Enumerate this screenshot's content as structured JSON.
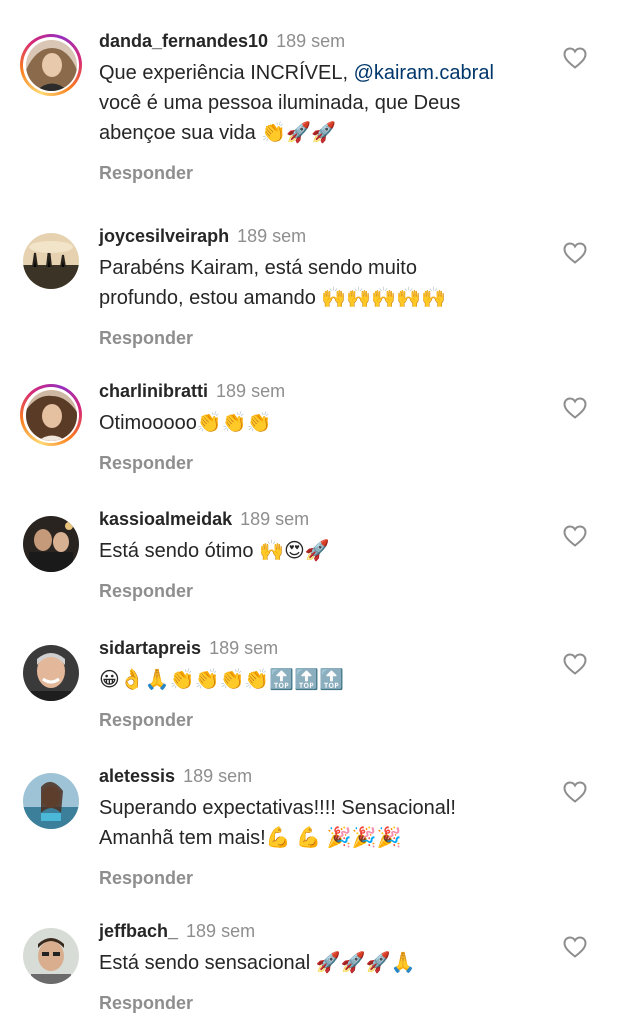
{
  "reply_label": "Responder",
  "comments": [
    {
      "username": "danda_fernandes10",
      "time": "189 sem",
      "text_part1": "Que experiência INCRÍVEL, ",
      "mention": "@kairam.cabral",
      "text_line2": "você é uma pessoa iluminada, que Deus",
      "text_line3": "abençoe sua vida 👏🚀🚀",
      "story_ring": true
    },
    {
      "username": "joycesilveiraph",
      "time": "189 sem",
      "text_line1": "Parabéns Kairam, está  sendo muito",
      "text_line2": "profundo, estou  amando 🙌🙌🙌🙌🙌",
      "story_ring": false
    },
    {
      "username": "charlinibratti",
      "time": "189 sem",
      "text_line1": "Otimooooo👏👏👏",
      "story_ring": true
    },
    {
      "username": "kassioalmeidak",
      "time": "189 sem",
      "text_line1": "Está sendo ótimo 🙌😍🚀",
      "story_ring": false
    },
    {
      "username": "sidartapreis",
      "time": "189 sem",
      "text_line1": "😀👌🙏👏👏👏👏🔝🔝🔝",
      "story_ring": false
    },
    {
      "username": "aletessis",
      "time": "189 sem",
      "text_line1": "Superando expectativas!!!! Sensacional!",
      "text_line2": "Amanhã tem mais!💪 💪 🎉🎉🎉",
      "story_ring": false
    },
    {
      "username": "jeffbach_",
      "time": "189 sem",
      "text_line1": "Está sendo sensacional 🚀🚀🚀🙏",
      "story_ring": false
    }
  ],
  "colors": {
    "text": "#262626",
    "muted": "#8e8e8e",
    "mention": "#00376b",
    "story_ring": [
      "#feda75",
      "#fa7e1e",
      "#d62976",
      "#962fbf"
    ]
  },
  "icons": {
    "like": "heart-outline-icon"
  }
}
